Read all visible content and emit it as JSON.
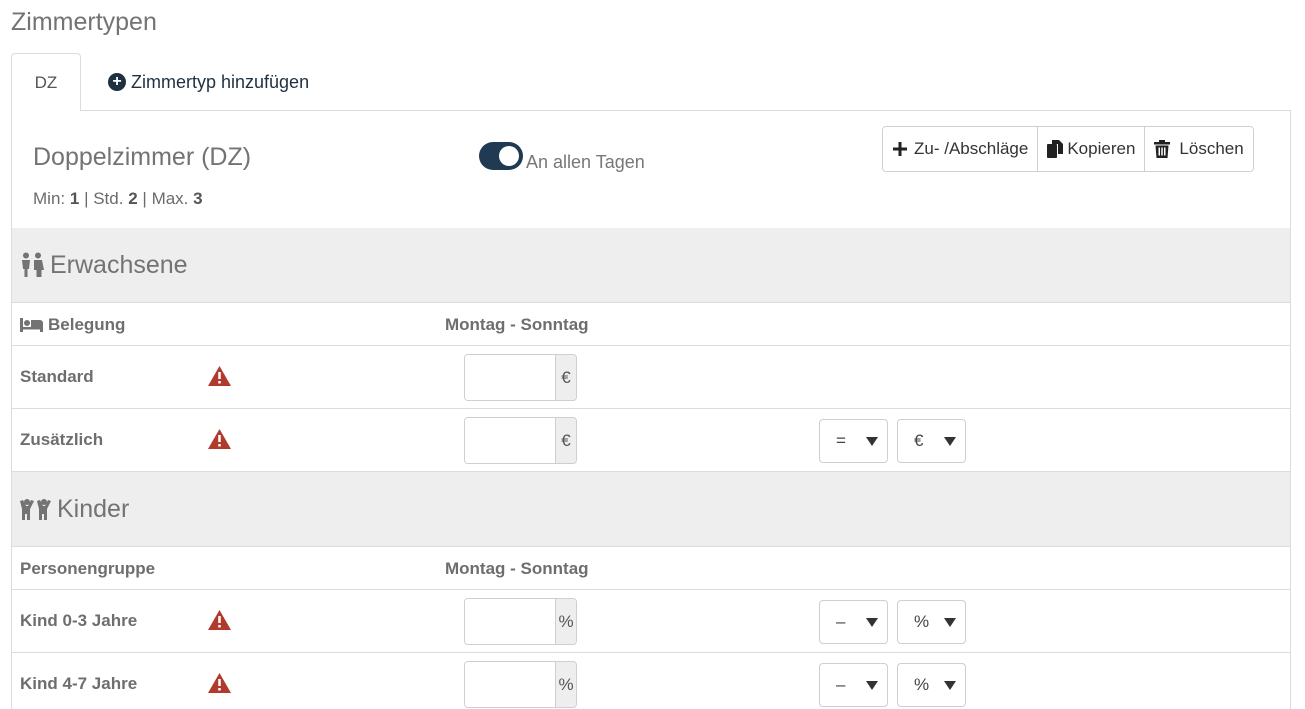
{
  "page": {
    "title": "Zimmertypen"
  },
  "tabs": {
    "active": "DZ",
    "add_label": "Zimmertyp hinzufügen"
  },
  "room": {
    "title": "Doppelzimmer (DZ)",
    "min_label": "Min:",
    "min": "1",
    "std_label": "Std.",
    "std": "2",
    "max_label": "Max.",
    "max": "3",
    "sep": "|"
  },
  "toggle": {
    "label": "An allen Tagen",
    "on": true
  },
  "actions": {
    "surcharge": "Zu- /Abschläge",
    "copy": "Kopieren",
    "delete": "Löschen"
  },
  "adults": {
    "heading": "Erwachsene",
    "col_occupancy": "Belegung",
    "col_days": "Montag - Sonntag",
    "rows": [
      {
        "label": "Standard",
        "value": "",
        "unit": "€"
      },
      {
        "label": "Zusätzlich",
        "value": "",
        "unit": "€",
        "operator": "=",
        "mode": "€"
      }
    ]
  },
  "children": {
    "heading": "Kinder",
    "col_group": "Personengruppe",
    "col_days": "Montag - Sonntag",
    "rows": [
      {
        "label": "Kind 0-3 Jahre",
        "value": "",
        "unit": "%",
        "operator": "–",
        "mode": "%"
      },
      {
        "label": "Kind 4-7 Jahre",
        "value": "",
        "unit": "%",
        "operator": "–",
        "mode": "%"
      }
    ]
  },
  "colors": {
    "accent": "#1f3a52",
    "warning": "#b03a2e",
    "section_bg": "#eeeeee"
  }
}
